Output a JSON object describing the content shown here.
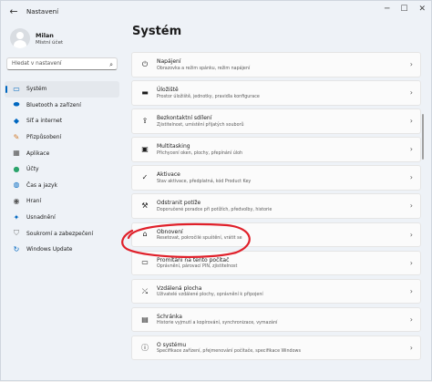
{
  "window": {
    "title": "Nastavení"
  },
  "profile": {
    "name": "Milan",
    "account_type": "Místní účet"
  },
  "search": {
    "placeholder": "Hledat v nastavení"
  },
  "sidebar": {
    "items": [
      {
        "label": "Systém",
        "icon": "monitor-icon",
        "active": true
      },
      {
        "label": "Bluetooth a zařízení",
        "icon": "bluetooth-icon"
      },
      {
        "label": "Síť a internet",
        "icon": "wifi-icon"
      },
      {
        "label": "Přizpůsobení",
        "icon": "brush-icon"
      },
      {
        "label": "Aplikace",
        "icon": "apps-icon"
      },
      {
        "label": "Účty",
        "icon": "person-icon"
      },
      {
        "label": "Čas a jazyk",
        "icon": "globe-clock-icon"
      },
      {
        "label": "Hraní",
        "icon": "gamepad-icon"
      },
      {
        "label": "Usnadnění",
        "icon": "accessibility-icon"
      },
      {
        "label": "Soukromí a zabezpečení",
        "icon": "shield-icon"
      },
      {
        "label": "Windows Update",
        "icon": "update-icon"
      }
    ]
  },
  "main": {
    "title": "Systém",
    "cards": [
      {
        "title": "Napájení",
        "subtitle": "Obrazovka a režim spánku, režim napájení",
        "icon": "power-icon"
      },
      {
        "title": "Úložiště",
        "subtitle": "Prostor úložiště, jednotky, pravidla konfigurace",
        "icon": "storage-icon"
      },
      {
        "title": "Bezkontaktní sdílení",
        "subtitle": "Zjistitelnost, umístění přijatých souborů",
        "icon": "share-icon"
      },
      {
        "title": "Multitasking",
        "subtitle": "Přichycení oken, plochy, přepínání úloh",
        "icon": "multitasking-icon"
      },
      {
        "title": "Aktivace",
        "subtitle": "Stav aktivace, předplatná, kód Product Key",
        "icon": "activation-icon"
      },
      {
        "title": "Odstranit potíže",
        "subtitle": "Doporučené poradce při potížích, předvolby, historie",
        "icon": "wrench-icon"
      },
      {
        "title": "Obnovení",
        "subtitle": "Resetovat, pokročilé spuštění, vrátit se",
        "icon": "recovery-icon"
      },
      {
        "title": "Promítání na tento počítač",
        "subtitle": "Oprávnění, párovací PIN, zjistitelnost",
        "icon": "projection-icon"
      },
      {
        "title": "Vzdálená plocha",
        "subtitle": "Uživatelé vzdálené plochy, oprávnění k připojení",
        "icon": "remote-desktop-icon"
      },
      {
        "title": "Schránka",
        "subtitle": "Historie vyjmutí a kopírování, synchronizace, vymazání",
        "icon": "clipboard-icon"
      },
      {
        "title": "O systému",
        "subtitle": "Specifikace zařízení, přejmenování počítače, specifikace Windows",
        "icon": "info-icon"
      }
    ]
  },
  "annotation_color": "#e0202a",
  "accent_color": "#0067c0"
}
